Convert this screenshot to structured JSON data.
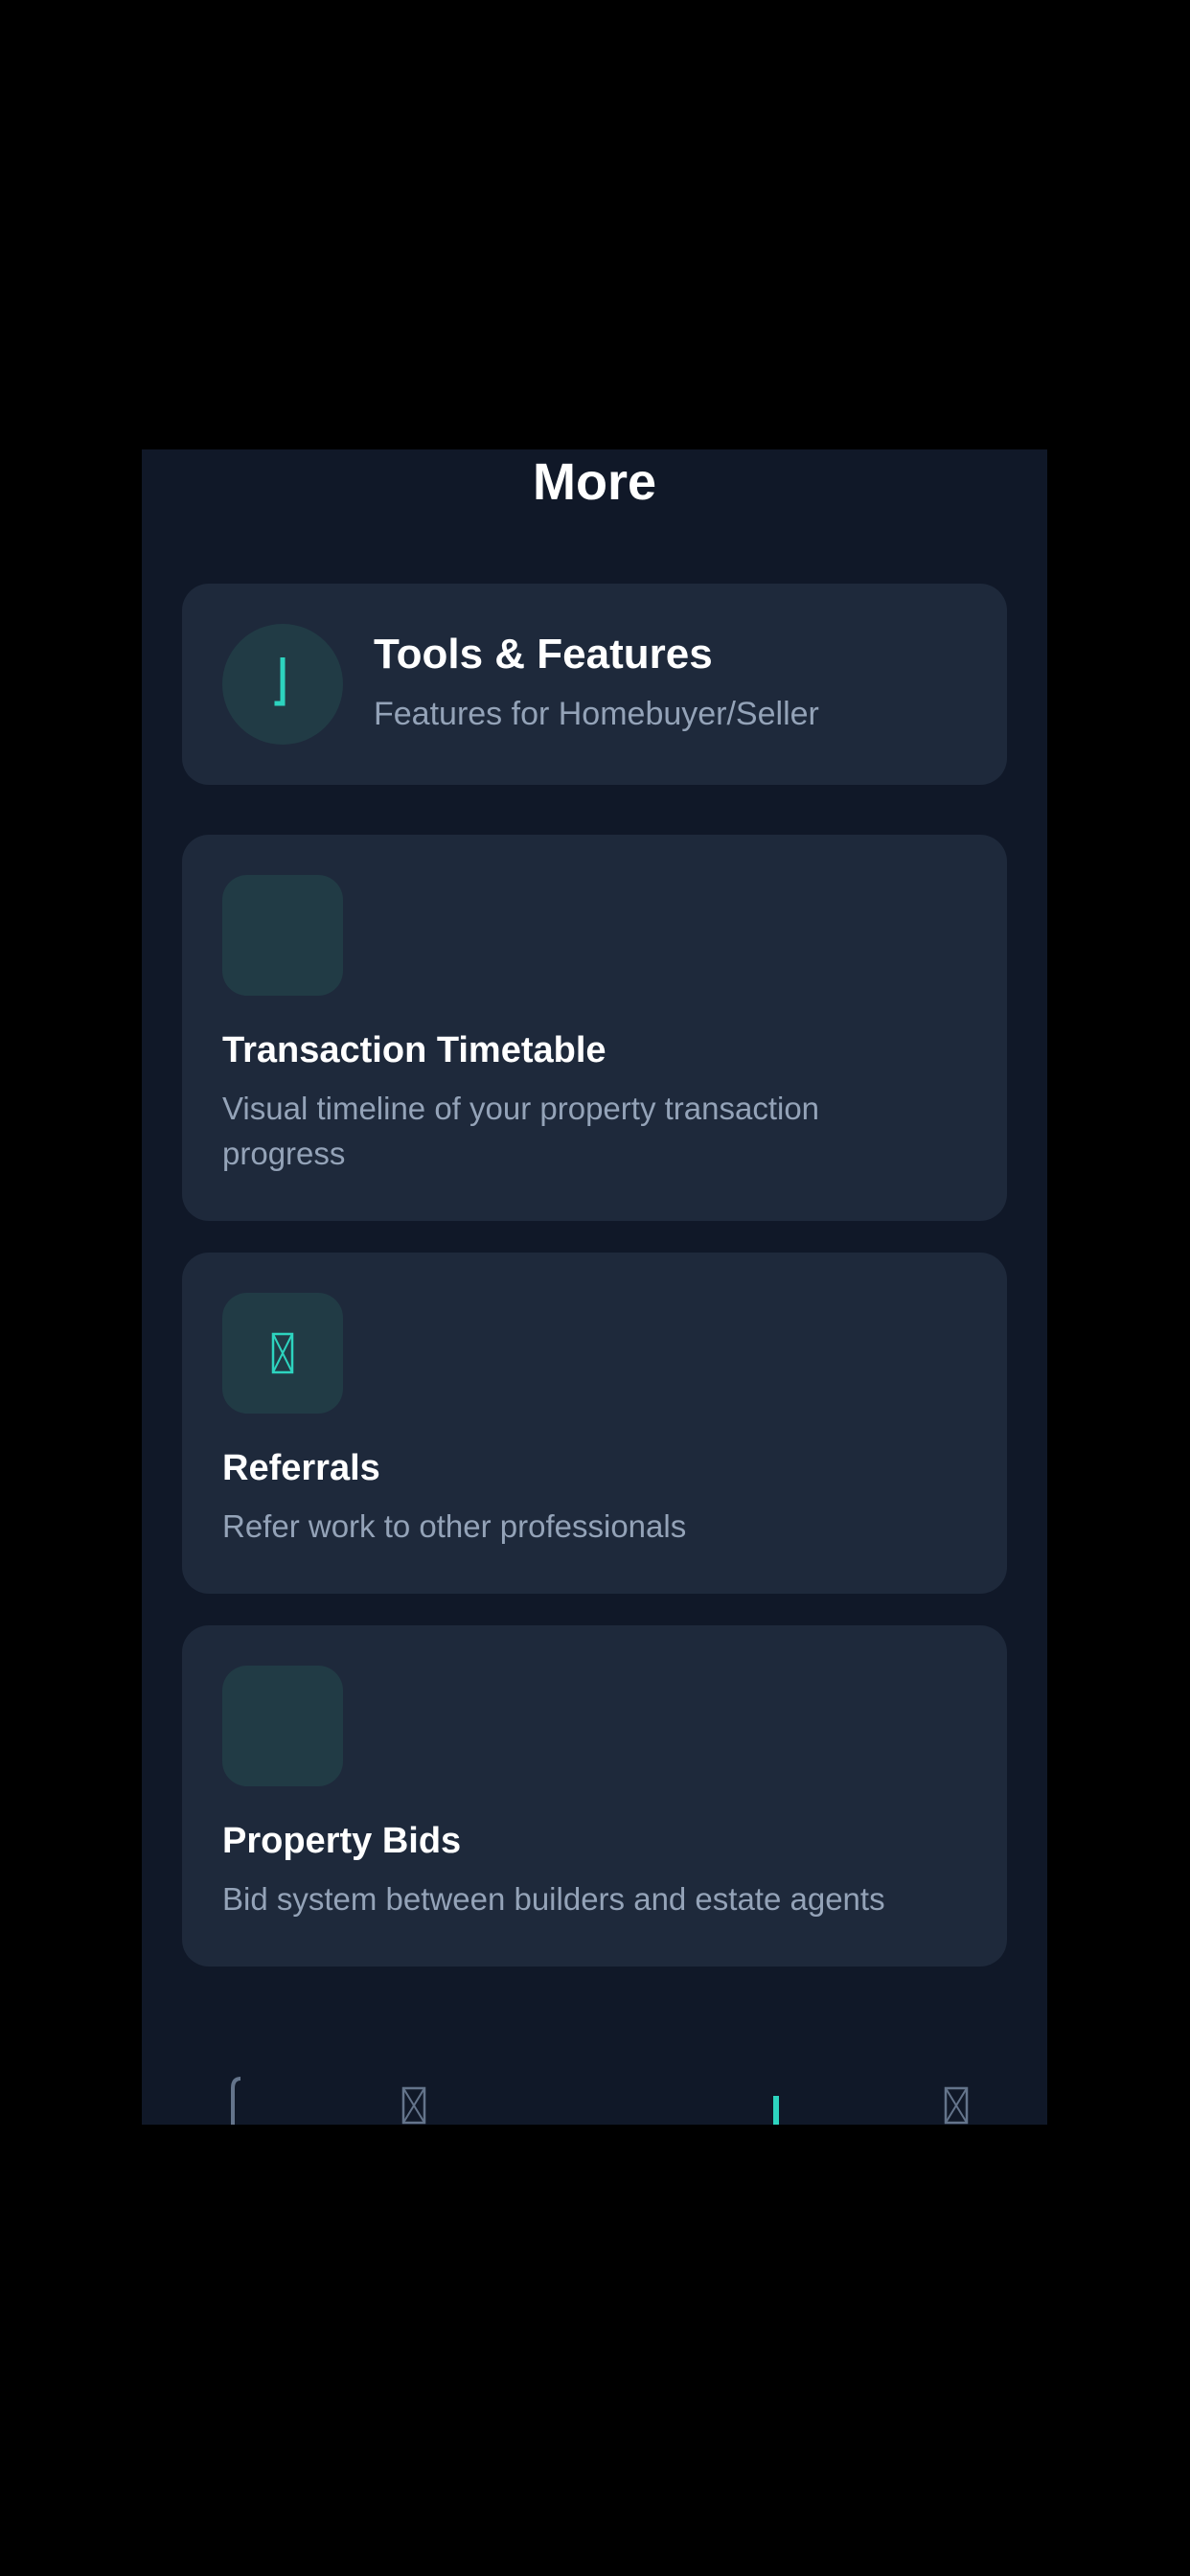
{
  "page": {
    "title": "More"
  },
  "header_card": {
    "icon": "tools-icon",
    "title": "Tools & Features",
    "subtitle": "Features for Homebuyer/Seller"
  },
  "features": [
    {
      "icon": "timeline-icon",
      "title": "Transaction Timetable",
      "description": "Visual timeline of your property transaction progress"
    },
    {
      "icon": "referral-icon",
      "title": "Referrals",
      "description": "Refer work to other professionals"
    },
    {
      "icon": "bid-icon",
      "title": "Property Bids",
      "description": "Bid system between builders and estate agents"
    }
  ],
  "tab_bar": {
    "tabs": [
      {
        "icon": "home-icon",
        "active": false
      },
      {
        "icon": "search-icon",
        "active": false
      },
      {
        "icon": "more-icon",
        "active": true
      },
      {
        "icon": "profile-icon",
        "active": false
      }
    ]
  },
  "colors": {
    "background": "#101828",
    "card": "#1e293b",
    "icon_bg": "#213b45",
    "accent": "#2dd4bf",
    "text_primary": "#ffffff",
    "text_secondary": "#94a3b8",
    "tab_inactive": "#64748b"
  }
}
